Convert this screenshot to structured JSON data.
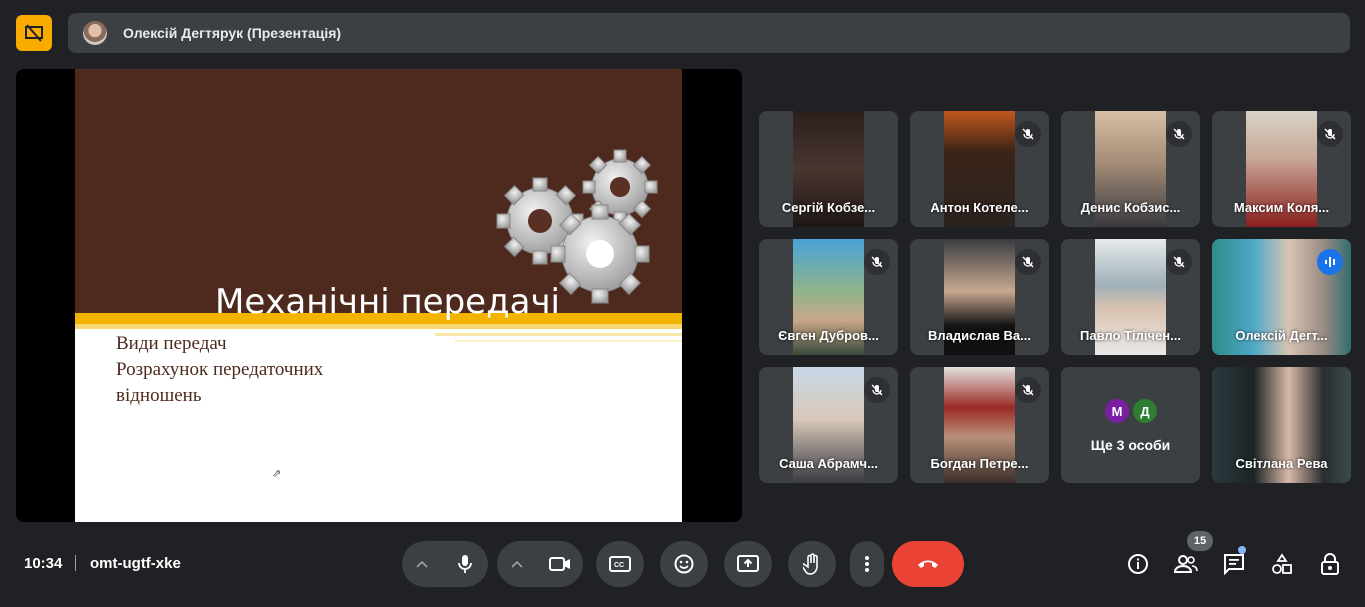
{
  "header": {
    "presenter_title": "Олексій Дегтярук (Презентація)"
  },
  "slide": {
    "title": "Механічні передачі",
    "bullet1": "Види передач",
    "bullet2": "Розрахунок  передаточних",
    "bullet3": "відношень"
  },
  "participants": [
    {
      "name": "Сергій Кобзе...",
      "muted": false
    },
    {
      "name": "Антон Котеле...",
      "muted": true
    },
    {
      "name": "Денис Кобзис...",
      "muted": true
    },
    {
      "name": "Максим Коля...",
      "muted": true
    },
    {
      "name": "Євген Дубров...",
      "muted": true
    },
    {
      "name": "Владислав Ва...",
      "muted": true
    },
    {
      "name": "Павло Тілічен...",
      "muted": true
    },
    {
      "name": "Олексій Дегт...",
      "speaking": true
    },
    {
      "name": "Саша Абрамч...",
      "muted": true
    },
    {
      "name": "Богдан Петре...",
      "muted": true
    },
    {
      "name": "Світлана Рева",
      "muted": false
    }
  ],
  "more_tile": {
    "avatar1": "М",
    "avatar2": "Д",
    "label": "Ще 3 особи",
    "avatar1_color": "#7b1fa2",
    "avatar2_color": "#2e7d32"
  },
  "bottom": {
    "time": "10:34",
    "meeting_code": "omt-ugtf-xke",
    "people_count": "15"
  },
  "colors": {
    "end_call": "#ea4335",
    "presentation_badge": "#f9ab00",
    "slide_header": "#4e2a1e",
    "slide_stripe": "#f3b400"
  }
}
